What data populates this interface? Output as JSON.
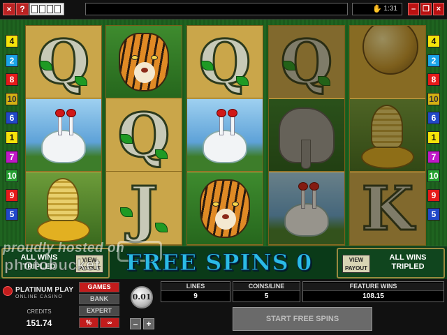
{
  "topbar": {
    "close_label": "×",
    "help_label": "?",
    "time": "1:31",
    "minimize_label": "–",
    "restore_label": "❐",
    "window_close_label": "×"
  },
  "paylines_left": [
    "4",
    "2",
    "8",
    "10",
    "6",
    "1",
    "7",
    "10",
    "9",
    "5"
  ],
  "paylines_right": [
    "4",
    "2",
    "8",
    "10",
    "6",
    "1",
    "7",
    "10",
    "9",
    "5"
  ],
  "reels": [
    [
      "Q",
      "crane",
      "cobra"
    ],
    [
      "tiger",
      "Q",
      "J"
    ],
    [
      "Q",
      "crane",
      "tiger"
    ],
    [
      "Q",
      "elephant",
      "crane"
    ],
    [
      "gold",
      "cobra",
      "K"
    ]
  ],
  "strip": {
    "view_payout_label": "VIEW PAYOUT",
    "all_wins_tripled": "ALL WINS TRIPLED",
    "free_spins_label": "FREE SPINS",
    "free_spins_count": "0",
    "watermark_line1": "proudly hosted on",
    "watermark_line2": "photobucket"
  },
  "panel": {
    "brand": "PLATINUM PLAY",
    "brand_sub": "ONLINE CASINO",
    "credits_label": "CREDITS",
    "credits_value": "151.74",
    "games_label": "GAMES",
    "bank_label": "BANK",
    "expert_label": "EXPERT",
    "percent_label": "%",
    "oo_label": "∞",
    "coin_value": "0.01",
    "minus_label": "–",
    "plus_label": "+",
    "lines_label": "LINES",
    "lines_value": "9",
    "coins_label": "COINS/LINE",
    "coins_value": "5",
    "feature_label": "FEATURE WINS",
    "feature_value": "108.15",
    "start_label": "START FREE SPINS"
  }
}
